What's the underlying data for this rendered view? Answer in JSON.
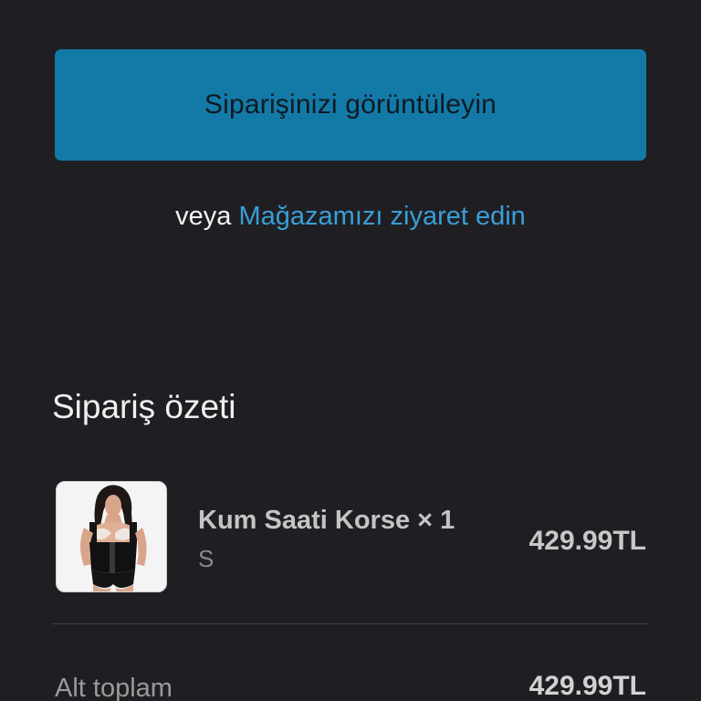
{
  "actions": {
    "view_order_label": "Siparişinizi görüntüleyin",
    "or_text": "veya",
    "store_link_label": "Mağazamızı ziyaret edin"
  },
  "summary": {
    "title": "Sipariş özeti",
    "items": [
      {
        "name": "Kum Saati Korse × 1",
        "variant": "S",
        "price": "429.99TL",
        "thumbnail_icon": "corset-product-photo"
      }
    ],
    "subtotal_label": "Alt toplam",
    "subtotal_value": "429.99TL"
  },
  "colors": {
    "background": "#1f1f23",
    "button_bg": "#137aa8",
    "link": "#3a9ed6"
  }
}
